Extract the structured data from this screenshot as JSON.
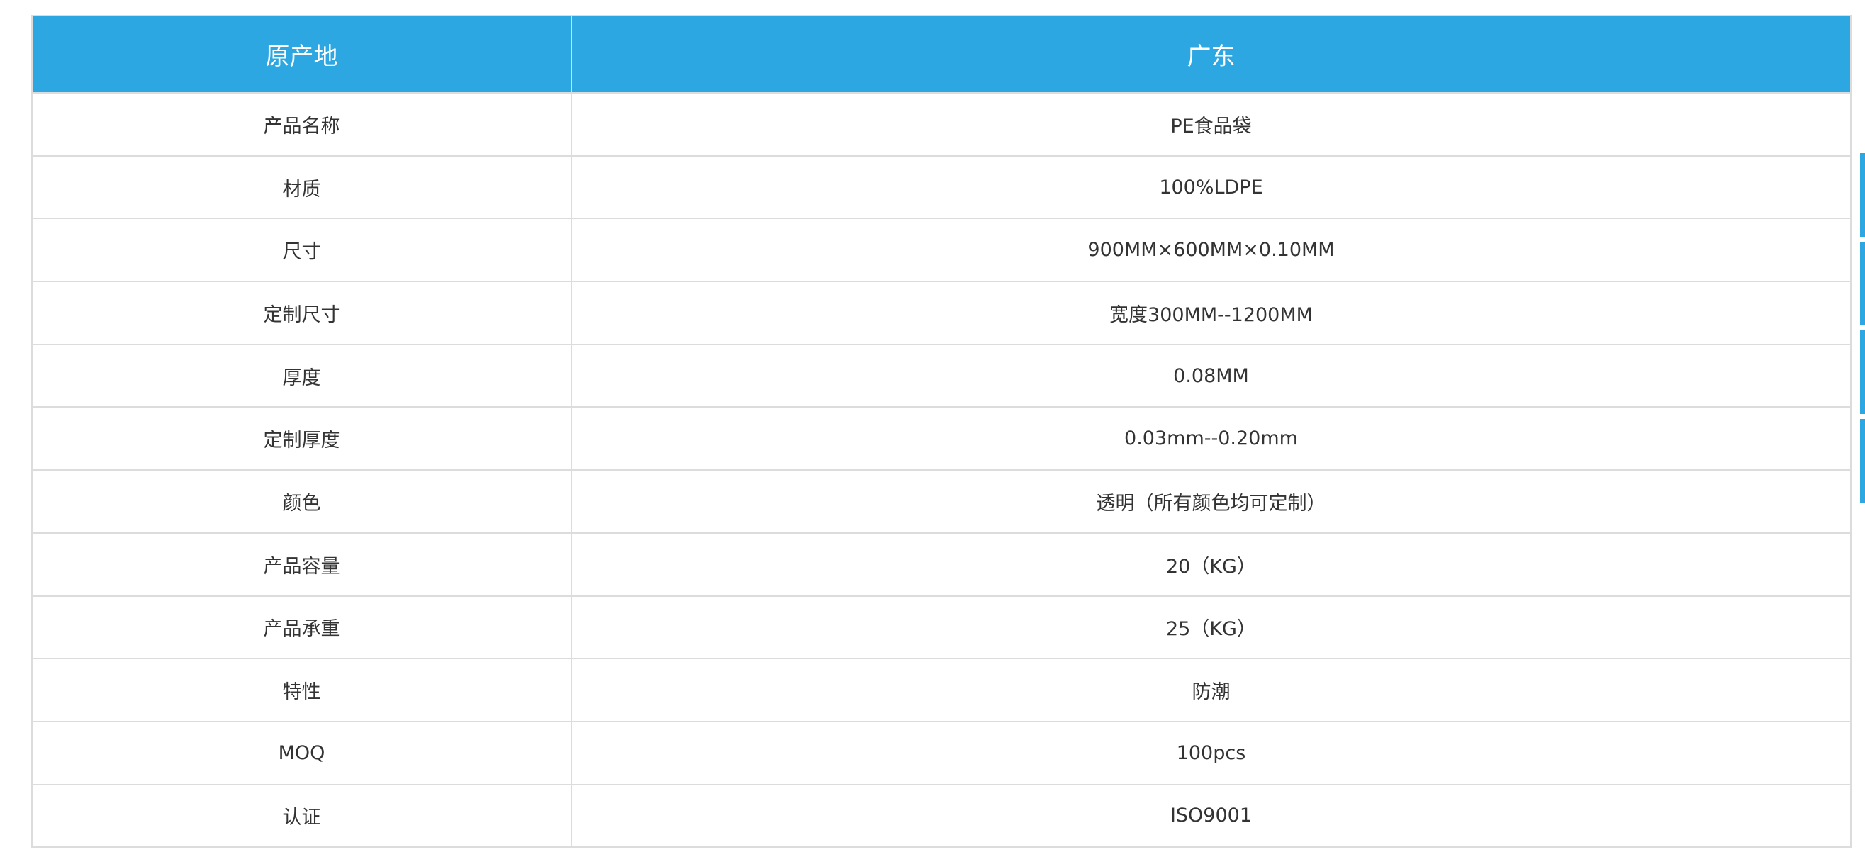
{
  "header": {
    "label": "原产地",
    "value": "广东"
  },
  "rows": [
    {
      "label": "产品名称",
      "value": "PE食品袋"
    },
    {
      "label": "材质",
      "value": "100%LDPE"
    },
    {
      "label": "尺寸",
      "value": "900MM×600MM×0.10MM"
    },
    {
      "label": "定制尺寸",
      "value": "宽度300MM--1200MM"
    },
    {
      "label": "厚度",
      "value": "0.08MM"
    },
    {
      "label": "定制厚度",
      "value": "0.03mm--0.20mm"
    },
    {
      "label": "颜色",
      "value": "透明（所有颜色均可定制）"
    },
    {
      "label": "产品容量",
      "value": "20（KG）"
    },
    {
      "label": "产品承重",
      "value": "25（KG）"
    },
    {
      "label": "特性",
      "value": "防潮"
    },
    {
      "label": "MOQ",
      "value": "100pcs"
    },
    {
      "label": "认证",
      "value": "ISO9001"
    }
  ],
  "colors": {
    "header_bg": "#2da7e1",
    "border": "#dcdcdc",
    "text": "#333333"
  }
}
